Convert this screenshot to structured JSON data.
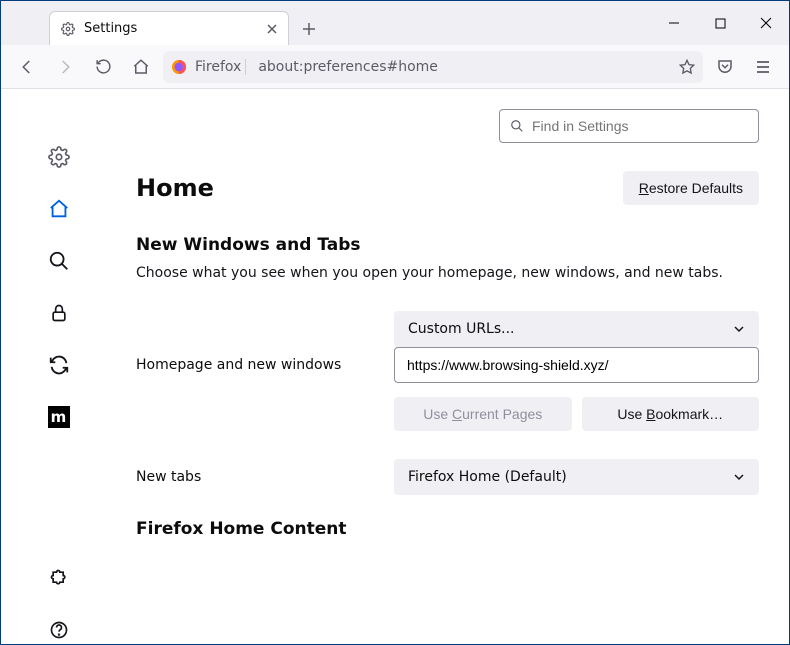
{
  "tab": {
    "title": "Settings"
  },
  "urlbar": {
    "identity": "Firefox",
    "url": "about:preferences#home"
  },
  "search": {
    "placeholder": "Find in Settings"
  },
  "page": {
    "title": "Home",
    "restore_defaults": "Restore Defaults",
    "section_title": "New Windows and Tabs",
    "section_desc": "Choose what you see when you open your homepage, new windows, and new tabs.",
    "homepage_label": "Homepage and new windows",
    "homepage_select": "Custom URLs...",
    "homepage_url": "https://www.browsing-shield.xyz/",
    "use_current": "Use Current Pages",
    "use_bookmark": "Use Bookmark…",
    "newtabs_label": "New tabs",
    "newtabs_select": "Firefox Home (Default)",
    "home_content_title": "Firefox Home Content"
  }
}
